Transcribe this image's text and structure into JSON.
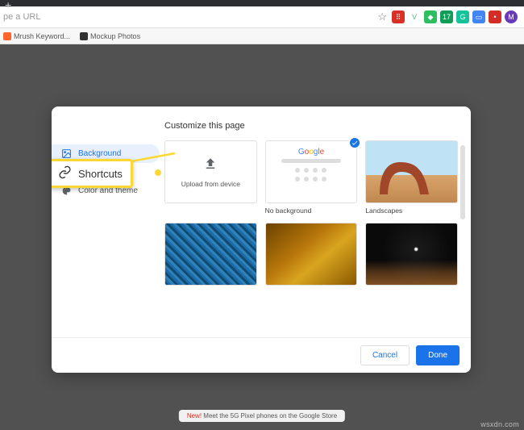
{
  "omnibox": {
    "placeholder": "pe a URL"
  },
  "bookmarks": [
    {
      "label": "Mrush Keyword..."
    },
    {
      "label": "Mockup Photos"
    }
  ],
  "ext_icons": [
    {
      "name": "ext-translate",
      "bg": "#d93025",
      "glyph": "⠿"
    },
    {
      "name": "ext-vue",
      "bg": "transparent",
      "glyph": "V",
      "color": "#4fc08d"
    },
    {
      "name": "ext-evernote",
      "bg": "#2dbe60",
      "glyph": "◆"
    },
    {
      "name": "ext-badge1",
      "bg": "#0f9d58",
      "glyph": "17"
    },
    {
      "name": "ext-grammarly",
      "bg": "#15c39a",
      "glyph": "G"
    },
    {
      "name": "ext-chat",
      "bg": "#4285f4",
      "glyph": "▭"
    },
    {
      "name": "ext-lastpass",
      "bg": "#d32d27",
      "glyph": "•"
    },
    {
      "name": "ext-avatar",
      "bg": "#673ab7",
      "glyph": "M"
    }
  ],
  "dialog": {
    "title": "Customize this page",
    "sidebar": [
      {
        "key": "background",
        "label": "Background",
        "active": true
      },
      {
        "key": "shortcuts",
        "label": "Shortcuts",
        "active": false,
        "highlight": true
      },
      {
        "key": "color",
        "label": "Color and theme",
        "active": false
      }
    ],
    "tiles": {
      "upload": "Upload from device",
      "nobg": "No background",
      "landscapes": "Landscapes"
    },
    "buttons": {
      "cancel": "Cancel",
      "done": "Done"
    }
  },
  "callout": {
    "label": "Shortcuts"
  },
  "promo": {
    "prefix": "New!",
    "text": " Meet the 5G Pixel phones on the Google Store"
  },
  "watermark": "wsxdn.com"
}
